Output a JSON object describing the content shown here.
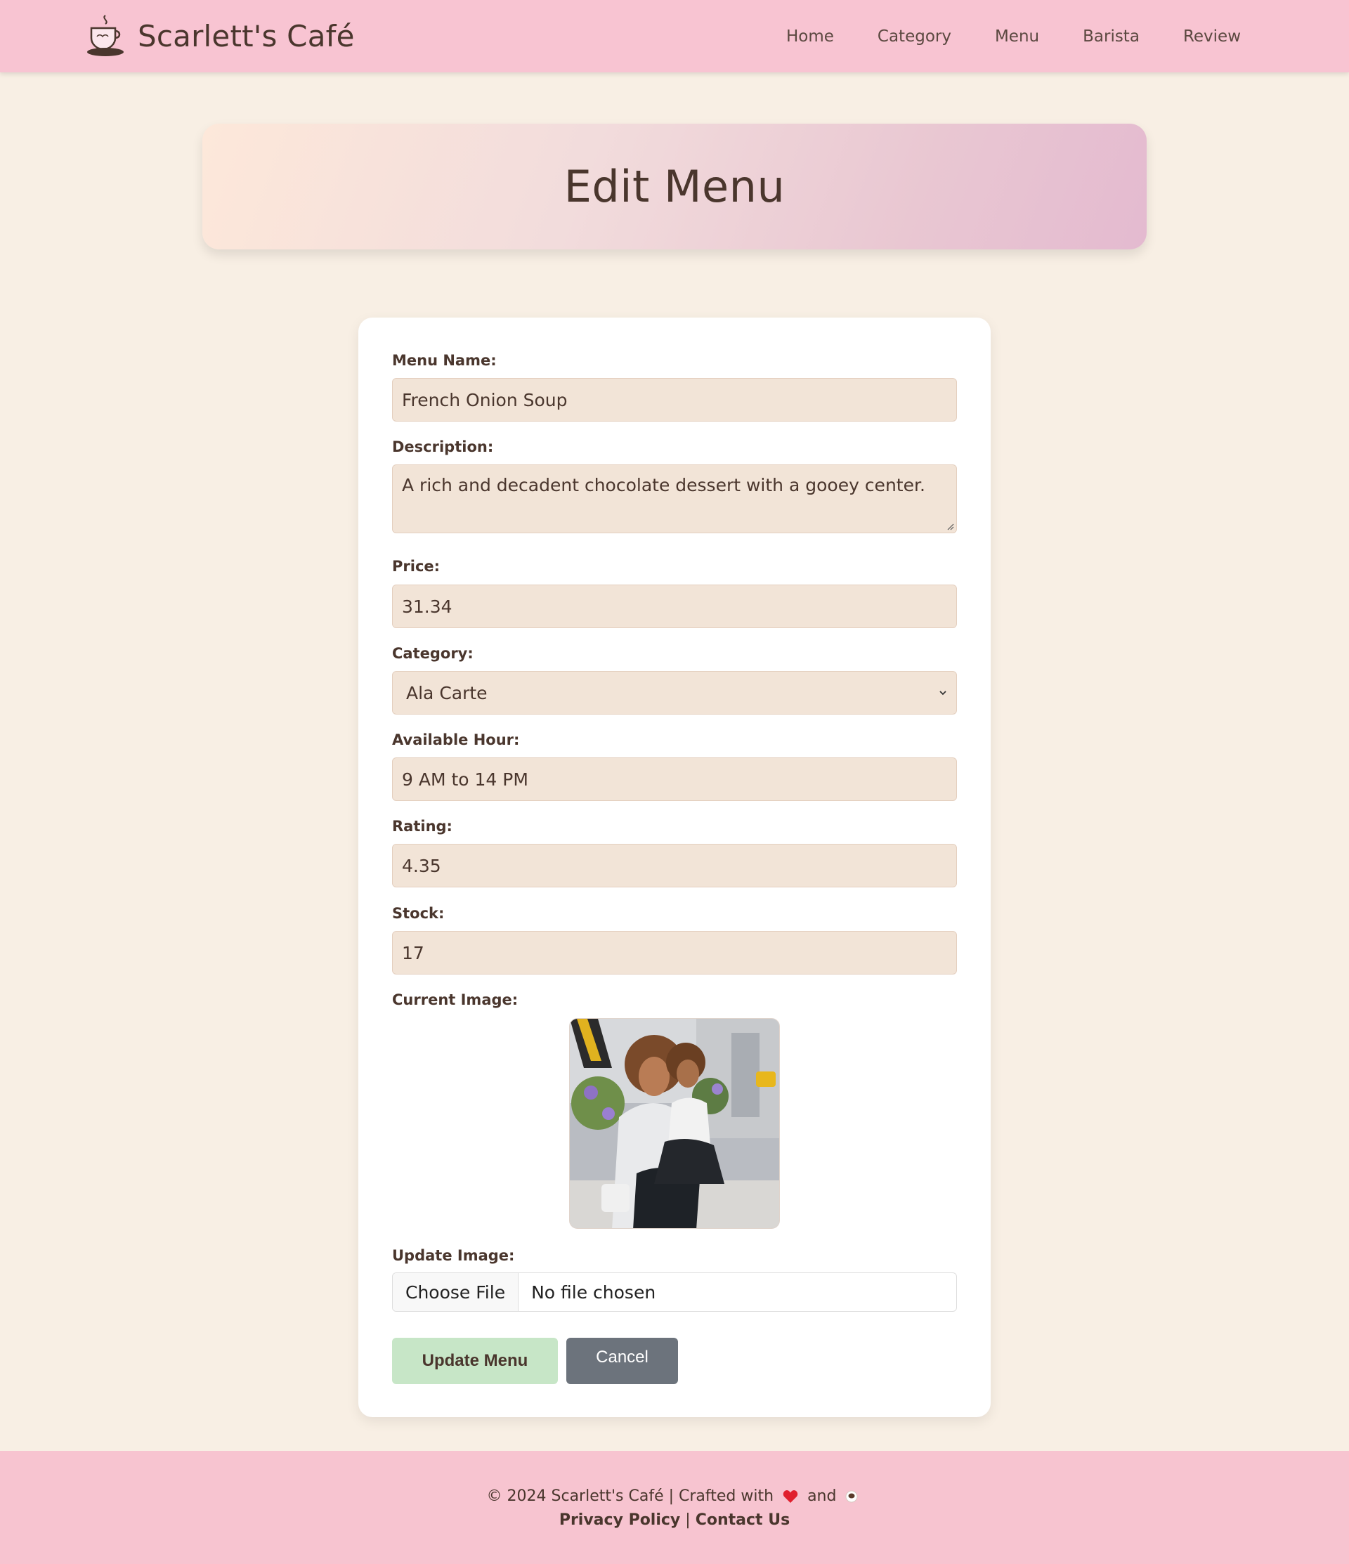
{
  "navbar": {
    "brand_name": "Scarlett's Café",
    "brand_icon": "coffee-cup-icon",
    "links": [
      "Home",
      "Category",
      "Menu",
      "Barista",
      "Review"
    ]
  },
  "banner": {
    "title": "Edit Menu"
  },
  "form": {
    "menu_name": {
      "label": "Menu Name:",
      "value": "French Onion Soup"
    },
    "description": {
      "label": "Description:",
      "value": "A rich and decadent chocolate dessert with a gooey center."
    },
    "price": {
      "label": "Price:",
      "value": "31.34"
    },
    "category": {
      "label": "Category:",
      "value": "Ala Carte"
    },
    "available_hour": {
      "label": "Available Hour:",
      "value": "9 AM to 14 PM"
    },
    "rating": {
      "label": "Rating:",
      "value": "4.35"
    },
    "stock": {
      "label": "Stock:",
      "value": "17"
    },
    "current_image": {
      "label": "Current Image:"
    },
    "update_image": {
      "label": "Update Image:",
      "button": "Choose File",
      "status": "No file chosen"
    },
    "update_button": "Update Menu",
    "cancel_button": "Cancel"
  },
  "footer": {
    "copyright_prefix": "© 2024 Scarlett's Café | Crafted with",
    "and_text": "and",
    "heart_icon": "heart-icon",
    "coffee_icon": "coffee-bean-icon",
    "privacy_link": "Privacy Policy",
    "separator": "|",
    "contact_link": "Contact Us"
  },
  "colors": {
    "navbar_bg": "#f8c4d2",
    "page_bg": "#f8efe4",
    "input_bg": "#f2e4d7",
    "update_button_bg": "#c7e6c7",
    "cancel_button_bg": "#6c737c",
    "text": "#4a362d",
    "heart": "#e0202e"
  }
}
